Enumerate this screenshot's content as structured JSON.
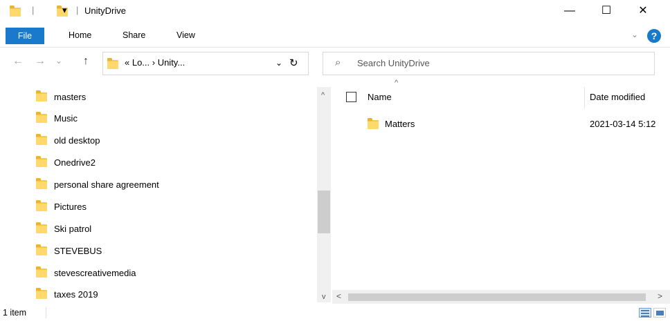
{
  "window": {
    "title": "UnityDrive",
    "qat_separator": "|",
    "qat_dropdown": "▾",
    "minimize": "—",
    "maximize": "☐",
    "close": "✕"
  },
  "ribbon": {
    "tabs": [
      "File",
      "Home",
      "Share",
      "View"
    ],
    "expand_chevron": "⌄",
    "help": "?"
  },
  "nav": {
    "back": "←",
    "forward": "→",
    "recent": "⌄",
    "up": "↑",
    "address_path": "« Lo... › Unity...",
    "address_dropdown": "⌄",
    "refresh": "↻",
    "search_placeholder": "Search UnityDrive",
    "search_icon": "⌕"
  },
  "navpane": {
    "items": [
      "masters",
      "Music",
      "old desktop",
      "Onedrive2",
      "personal share agreement",
      "Pictures",
      "Ski patrol",
      "STEVEBUS",
      "stevescreativemedia",
      "taxes 2019"
    ],
    "scroll_up": "^",
    "scroll_down": "v"
  },
  "content": {
    "columns": [
      "Name",
      "Date modified"
    ],
    "sort_indicator": "^",
    "rows": [
      {
        "name": "Matters",
        "date": "2021-03-14 5:12"
      }
    ],
    "scroll_left": "<",
    "scroll_right": ">"
  },
  "status": {
    "count": "1 item"
  },
  "icons": {
    "folder_color": "#f7c948",
    "accent": "#1979ca"
  }
}
